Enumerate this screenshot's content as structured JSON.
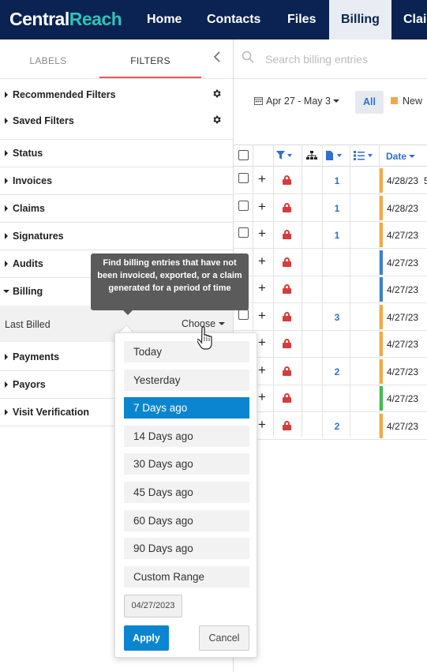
{
  "app": {
    "logo_part1": "Central",
    "logo_part2": "Reach",
    "nav": [
      "Home",
      "Contacts",
      "Files",
      "Billing",
      "Clai"
    ],
    "active_nav": "Billing"
  },
  "panel": {
    "tabs": [
      "LABELS",
      "FILTERS"
    ],
    "active_tab": "FILTERS",
    "sections": {
      "recommended": "Recommended Filters",
      "saved": "Saved Filters",
      "status": "Status",
      "invoices": "Invoices",
      "claims": "Claims",
      "signatures": "Signatures",
      "audits": "Audits",
      "billing": "Billing",
      "payments": "Payments",
      "payors": "Payors",
      "visit_verification": "Visit Verification"
    },
    "last_billed_label": "Last Billed",
    "choose_label": "Choose"
  },
  "search": {
    "placeholder": "Search billing entries"
  },
  "toolbar": {
    "date_range": "Apr 27 - May 3",
    "all_label": "All",
    "new_label": "New"
  },
  "grid": {
    "date_header": "Date",
    "rows": [
      {
        "count": "1",
        "date": "4/28/23",
        "color": "#f0a94a",
        "extra": "5"
      },
      {
        "count": "1",
        "date": "4/28/23",
        "color": "#f0a94a",
        "extra": ""
      },
      {
        "count": "1",
        "date": "4/27/23",
        "color": "#f0a94a",
        "extra": ""
      },
      {
        "count": "",
        "date": "4/27/23",
        "color": "#3b82c4",
        "extra": ""
      },
      {
        "count": "",
        "date": "4/27/23",
        "color": "#3b82c4",
        "extra": ""
      },
      {
        "count": "3",
        "date": "4/27/23",
        "color": "#f0a94a",
        "extra": ""
      },
      {
        "count": "",
        "date": "4/27/23",
        "color": "#f0a94a",
        "extra": ""
      },
      {
        "count": "2",
        "date": "4/27/23",
        "color": "#f0a94a",
        "extra": ""
      },
      {
        "count": "",
        "date": "4/27/23",
        "color": "#3dbb4f",
        "extra": ""
      },
      {
        "count": "2",
        "date": "4/27/23",
        "color": "#f0a94a",
        "extra": ""
      }
    ]
  },
  "tooltip": {
    "text": "Find billing entries that have not been invoiced, exported, or a claim generated for a period of time"
  },
  "dropdown": {
    "options": [
      "Today",
      "Yesterday",
      "7 Days ago",
      "14 Days ago",
      "30 Days ago",
      "45 Days ago",
      "60 Days ago",
      "90 Days ago",
      "Custom Range"
    ],
    "selected": "7 Days ago",
    "date_value": "04/27/2023",
    "apply_label": "Apply",
    "cancel_label": "Cancel"
  },
  "colors": {
    "nav_bg": "#0a2352",
    "accent_teal": "#2ec4b6",
    "primary_blue": "#0b85cf",
    "link_blue": "#2f6fd1",
    "lock_red": "#d93a3a",
    "status_new": "#f0a94a",
    "status_blue": "#3b82c4",
    "status_green": "#3dbb4f"
  }
}
